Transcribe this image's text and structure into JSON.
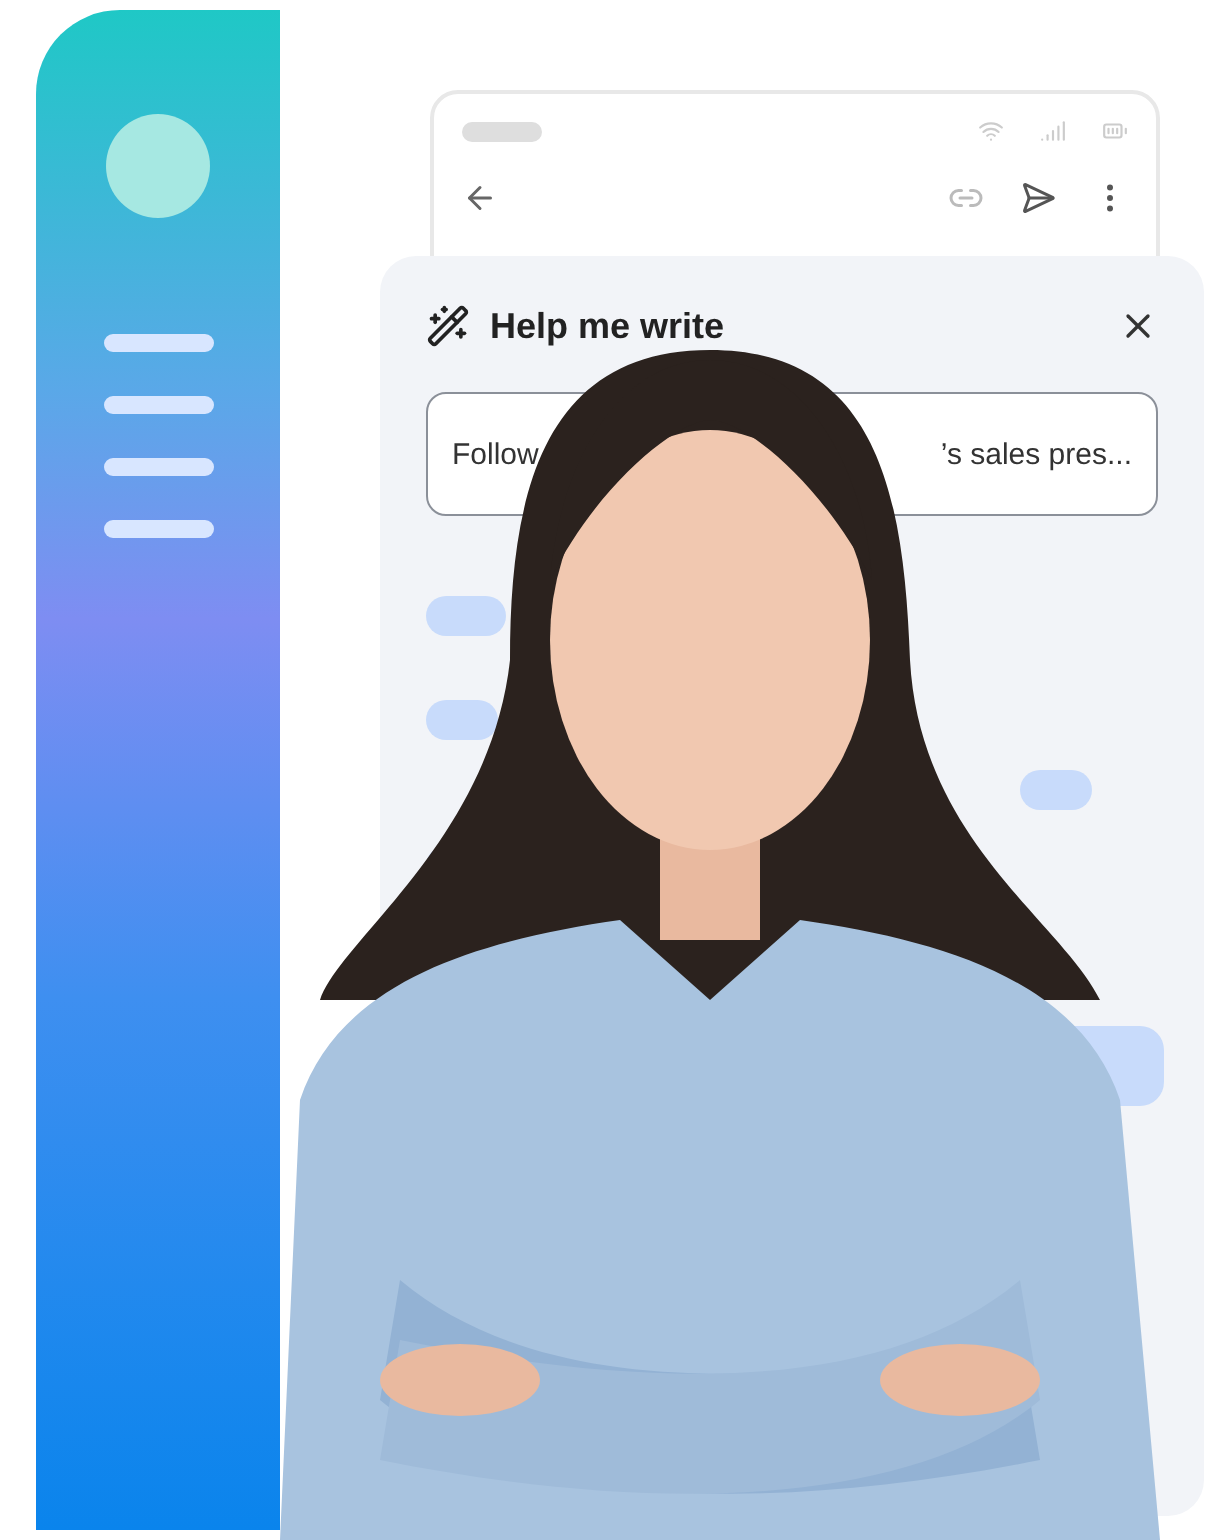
{
  "dialog": {
    "title": "Help me write",
    "field": {
      "value_start": "Follow",
      "value_end": "’s sales pres..."
    }
  }
}
